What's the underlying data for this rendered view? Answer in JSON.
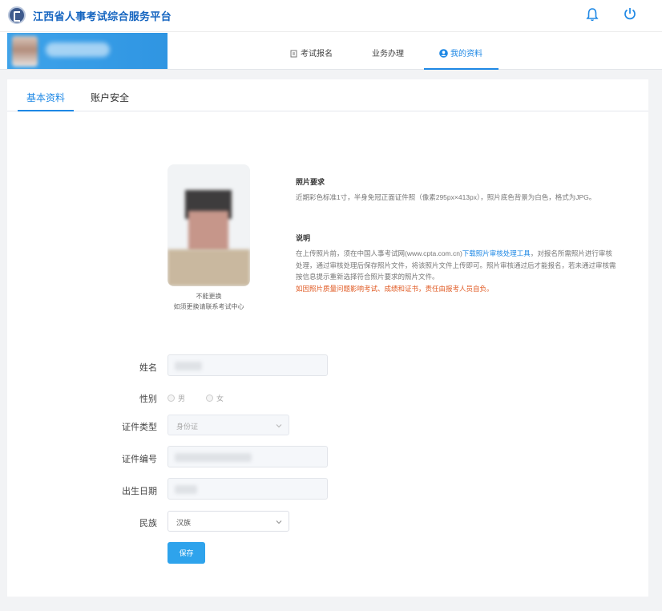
{
  "header": {
    "site_title": "江西省人事考试综合服务平台"
  },
  "nav": {
    "items": [
      {
        "label": "考试报名"
      },
      {
        "label": "业务办理"
      },
      {
        "label": "我的资料"
      }
    ],
    "active": "我的资料"
  },
  "tabs": [
    {
      "label": "基本资料"
    },
    {
      "label": "账户安全"
    }
  ],
  "photo": {
    "note_line1": "不能更换",
    "note_line2": "如须更换请联系考试中心"
  },
  "requirements": {
    "title": "照片要求",
    "text": "近期彩色标准1寸，半身免冠正面证件照（像素295px×413px），照片底色背景为白色，格式为JPG。"
  },
  "explanation": {
    "title": "说明",
    "text_before_link": "在上传照片前，须在中国人事考试网(www.cpta.com.cn)",
    "link": "下载照片审核处理工具",
    "text_after_link": "，对报名所需照片进行审核处理，通过审核处理后保存照片文件，将该照片文件上传即可。照片审核通过后才能报名，若未通过审核需按信息提示重新选择符合照片要求的照片文件。",
    "warning": "如因照片质量问题影响考试、成绩和证书，责任由报考人员自负。"
  },
  "form": {
    "name_label": "姓名",
    "gender_label": "性别",
    "gender_options": [
      "男",
      "女"
    ],
    "id_type_label": "证件类型",
    "id_type_value": "身份证",
    "id_number_label": "证件编号",
    "birth_label": "出生日期",
    "ethnicity_label": "民族",
    "ethnicity_value": "汉族",
    "save_label": "保存"
  },
  "colors": {
    "primary": "#1e88e5",
    "warning": "#e05a23",
    "button": "#2ea3ec"
  }
}
